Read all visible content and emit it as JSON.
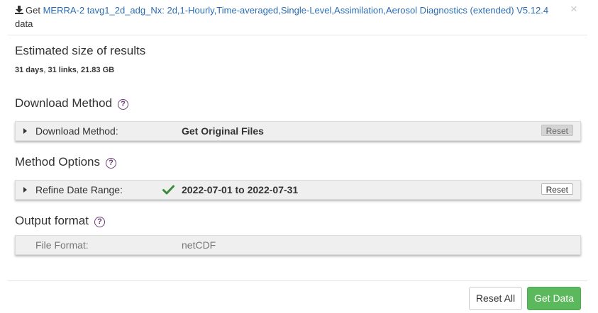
{
  "header": {
    "get_text": "Get",
    "dataset_link": "MERRA-2 tavg1_2d_adg_Nx: 2d,1-Hourly,Time-averaged,Single-Level,Assimilation,Aerosol Diagnostics (extended) V5.12.4",
    "suffix": "data",
    "close_glyph": "×"
  },
  "estimate": {
    "title": "Estimated size of results",
    "days": "31 days",
    "links": "31 links",
    "size": "21.83 GB"
  },
  "download_method": {
    "title": "Download Method",
    "help": "?",
    "row_label": "Download Method:",
    "row_value": "Get Original Files",
    "reset_label": "Reset",
    "reset_enabled": false
  },
  "method_options": {
    "title": "Method Options",
    "help": "?",
    "row_label": "Refine Date Range:",
    "row_value": "2022-07-01 to 2022-07-31",
    "reset_label": "Reset",
    "check_color": "#3c8a3c"
  },
  "output_format": {
    "title": "Output format",
    "help": "?",
    "row_label": "File Format:",
    "row_value": "netCDF"
  },
  "footer": {
    "reset_all_label": "Reset All",
    "get_data_label": "Get Data",
    "get_data_color": "#5cb85c"
  }
}
